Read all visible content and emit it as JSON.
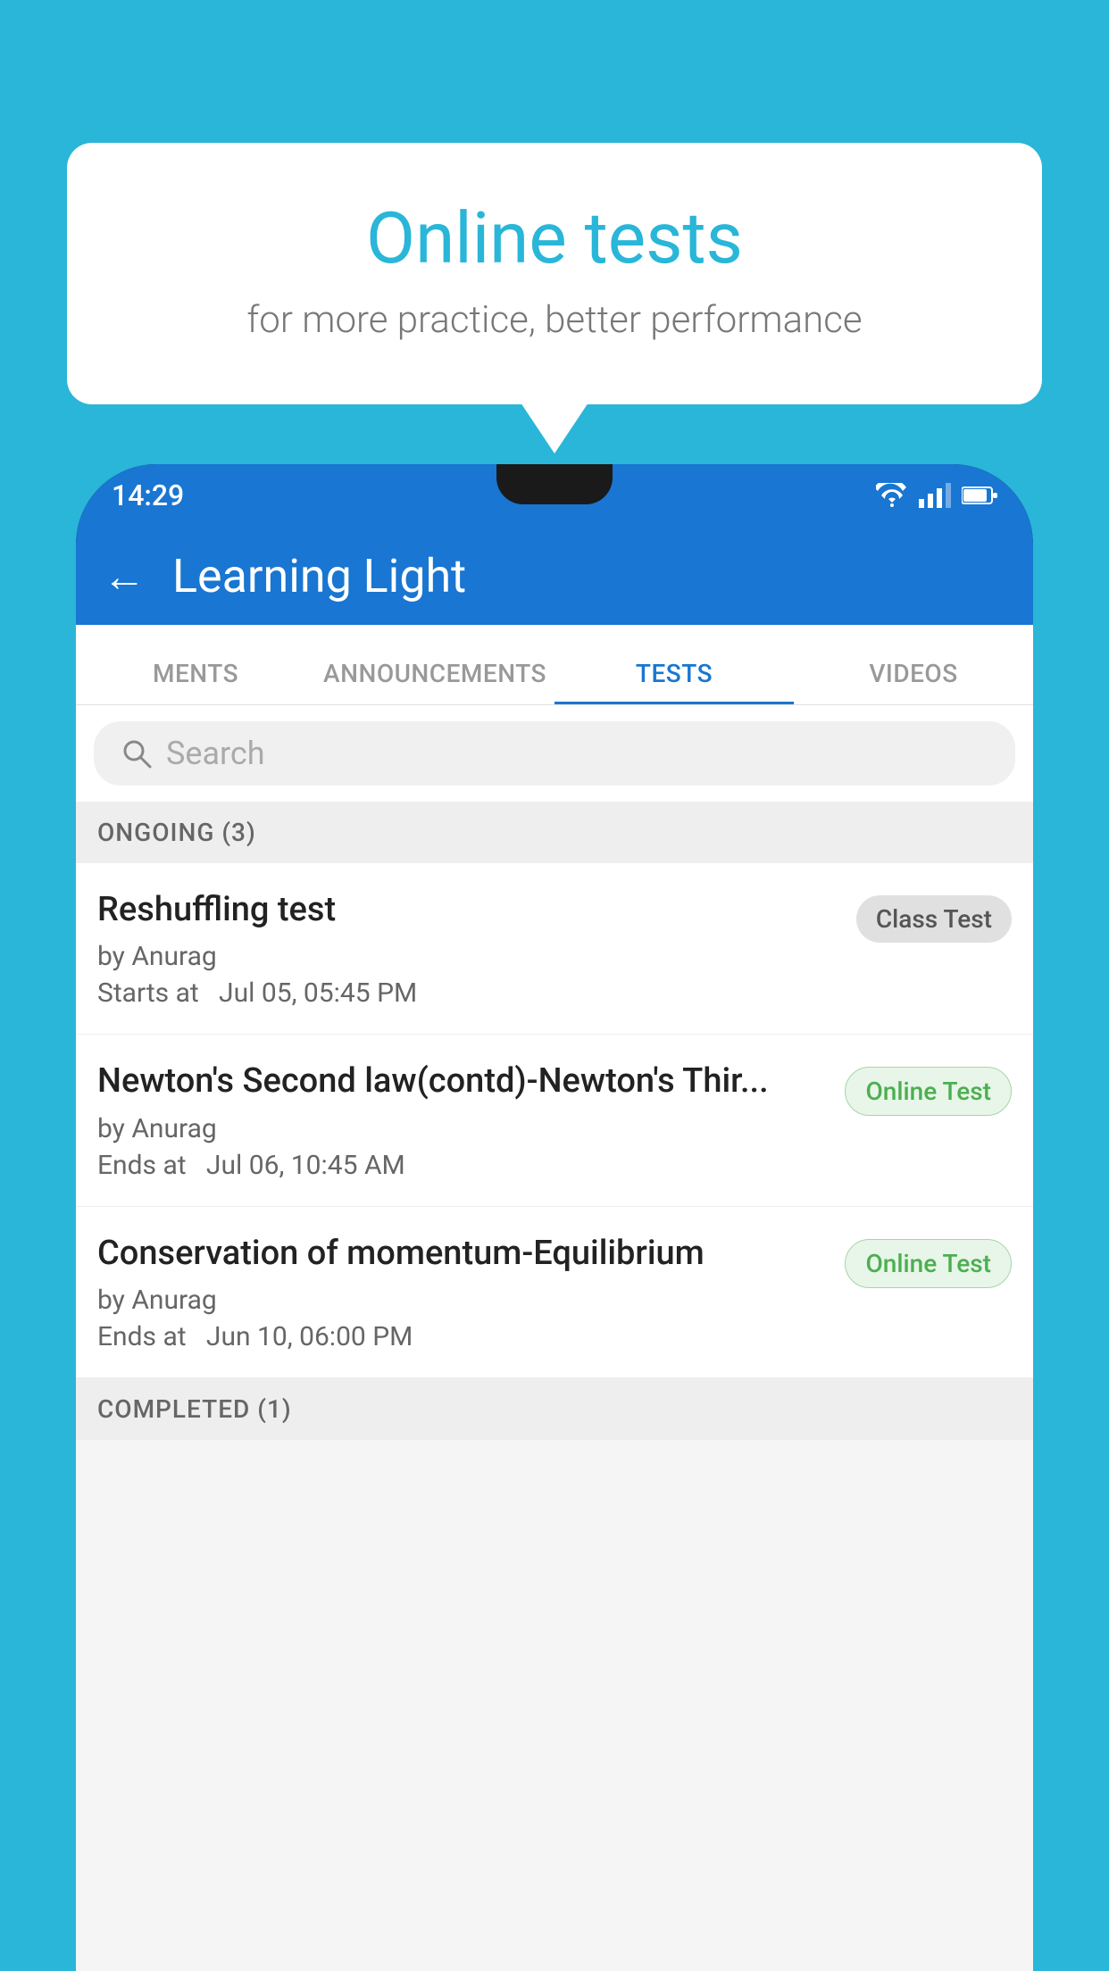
{
  "background_color": "#29B6D8",
  "bubble": {
    "title": "Online tests",
    "subtitle": "for more practice, better performance"
  },
  "phone": {
    "status_bar": {
      "time": "14:29",
      "icons": [
        "wifi",
        "signal",
        "battery"
      ]
    },
    "app_header": {
      "title": "Learning Light",
      "back_label": "←"
    },
    "tabs": [
      {
        "label": "MENTS",
        "active": false
      },
      {
        "label": "ANNOUNCEMENTS",
        "active": false
      },
      {
        "label": "TESTS",
        "active": true
      },
      {
        "label": "VIDEOS",
        "active": false
      }
    ],
    "search": {
      "placeholder": "Search"
    },
    "ongoing_section": {
      "header": "ONGOING (3)",
      "tests": [
        {
          "name": "Reshuffling test",
          "by": "by Anurag",
          "date": "Starts at  Jul 05, 05:45 PM",
          "badge": "Class Test",
          "badge_type": "class"
        },
        {
          "name": "Newton's Second law(contd)-Newton's Thir...",
          "by": "by Anurag",
          "date": "Ends at  Jul 06, 10:45 AM",
          "badge": "Online Test",
          "badge_type": "online"
        },
        {
          "name": "Conservation of momentum-Equilibrium",
          "by": "by Anurag",
          "date": "Ends at  Jun 10, 06:00 PM",
          "badge": "Online Test",
          "badge_type": "online"
        }
      ]
    },
    "completed_section": {
      "header": "COMPLETED (1)"
    }
  }
}
